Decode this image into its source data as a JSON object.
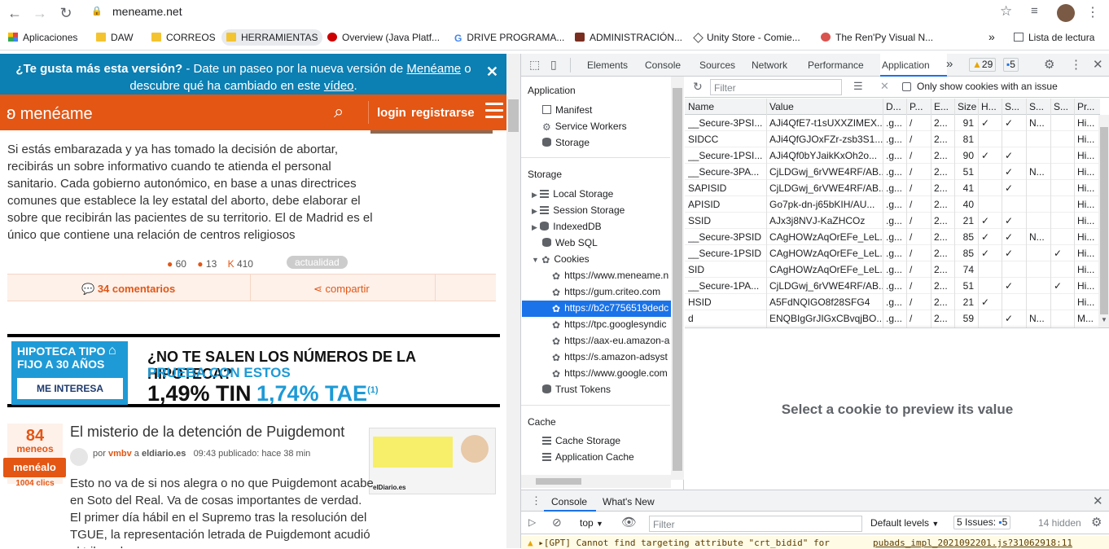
{
  "browser": {
    "url": "meneame.net",
    "bookmarks": [
      "Aplicaciones",
      "DAW",
      "CORREOS",
      "HERRAMIENTAS",
      "Overview (Java Platf...",
      "DRIVE PROGRAMA...",
      "ADMINISTRACIÓN...",
      "Unity Store - Comie...",
      "The Ren'Py Visual N...",
      "Lista de lectura"
    ]
  },
  "site": {
    "banner_q": "¿Te gusta más esta versión?",
    "banner_rest": " - Date un paseo por la nueva versión de ",
    "banner_link": "Menéame",
    "banner_rest2": " o descubre qué ha cambiado en este ",
    "banner_video": "vídeo",
    "banner_end": ".",
    "logo": "menéame",
    "login": "login",
    "register": "registrarse",
    "p1": "Si estás embarazada y ya has tomado la decisión de abortar, recibirás un sobre informativo cuando te atienda el personal sanitario. Cada gobierno autonómico, en base a unas directrices comunes que establece la ley estatal del aborto, debe elaborar el sobre que recibirán las pacientes de su territorio. El de Madrid es el único que contiene una relación de centros religiosos",
    "stat1": "60",
    "stat2": "13",
    "stat3": "410",
    "stat3_prefix": "K",
    "tag": "actualidad",
    "comments": "34 comentarios",
    "share": "compartir",
    "ad_left_title": "HIPOTECA TIPO FIJO A 30 AÑOS",
    "ad_button": "ME INTERESA",
    "ad_headline": "¿NO TE SALEN LOS NÚMEROS DE LA HIPOTECA?",
    "ad_sub": "PRUEBA CON ESTOS",
    "ad_tin": "1,49% TIN",
    "ad_tae": "1,74% TAE",
    "ad_tae_note": "(1)",
    "votes": "84",
    "votes_label": "meneos",
    "menealo": "menéalo",
    "clicks": "1004 clics",
    "title2": "El misterio de la detención de Puigdemont",
    "meta_por": "por",
    "meta_user": "vmbv",
    "meta_a": "a",
    "meta_site": "eldiario.es",
    "meta_time": "09:43 publicado: hace 38 min",
    "thumb_source": "elDiario.es",
    "p2": "Esto no va de si nos alegra o no que Puigdemont acabe en Soto del Real. Va de cosas importantes de verdad. El primer día hábil en el Supremo tras la resolución del TGUE, la representación letrada de Puigdemont acudió al tribunal para"
  },
  "devtools": {
    "tabs": [
      "Elements",
      "Console",
      "Sources",
      "Network",
      "Performance",
      "Application"
    ],
    "more": "»",
    "warnings": "29",
    "messages": "5",
    "sidebar": {
      "app_header": "Application",
      "app_items": [
        "Manifest",
        "Service Workers",
        "Storage"
      ],
      "storage_header": "Storage",
      "storage_items": [
        "Local Storage",
        "Session Storage",
        "IndexedDB",
        "Web SQL",
        "Cookies"
      ],
      "cookie_sites": [
        "https://www.meneame.n",
        "https://gum.criteo.com",
        "https://b2c7756519dedc",
        "https://tpc.googlesyndic",
        "https://aax-eu.amazon-a",
        "https://s.amazon-adsyst",
        "https://www.google.com"
      ],
      "trust": "Trust Tokens",
      "cache_header": "Cache",
      "cache_items": [
        "Cache Storage",
        "Application Cache"
      ]
    },
    "filter_placeholder": "Filter",
    "only_issue": "Only show cookies with an issue",
    "columns": [
      "Name",
      "Value",
      "D...",
      "P...",
      "E...",
      "Size",
      "H...",
      "S...",
      "S...",
      "S...",
      "Pr..."
    ],
    "rows": [
      [
        "__Secure-3PSI...",
        "AJi4QfE7-t1sUXXZIMEX...",
        ".g...",
        "/",
        "2...",
        "91",
        "✓",
        "✓",
        "N...",
        "",
        "Hi..."
      ],
      [
        "SIDCC",
        "AJi4QfGJOxFZr-zsb3S1...",
        ".g...",
        "/",
        "2...",
        "81",
        "",
        "",
        "",
        "",
        "Hi..."
      ],
      [
        "__Secure-1PSI...",
        "AJi4Qf0bYJaikKxOh2o...",
        ".g...",
        "/",
        "2...",
        "90",
        "✓",
        "✓",
        "",
        "",
        "Hi..."
      ],
      [
        "__Secure-3PA...",
        "CjLDGwj_6rVWE4RF/AB...",
        ".g...",
        "/",
        "2...",
        "51",
        "",
        "✓",
        "N...",
        "",
        "Hi..."
      ],
      [
        "SAPISID",
        "CjLDGwj_6rVWE4RF/AB...",
        ".g...",
        "/",
        "2...",
        "41",
        "",
        "✓",
        "",
        "",
        "Hi..."
      ],
      [
        "APISID",
        "Go7pk-dn-j65bKIH/AU...",
        ".g...",
        "/",
        "2...",
        "40",
        "",
        "",
        "",
        "",
        "Hi..."
      ],
      [
        "SSID",
        "AJx3j8NVJ-KaZHCOz",
        ".g...",
        "/",
        "2...",
        "21",
        "✓",
        "✓",
        "",
        "",
        "Hi..."
      ],
      [
        "__Secure-3PSID",
        "CAgHOWzAqOrEFe_LeL...",
        ".g...",
        "/",
        "2...",
        "85",
        "✓",
        "✓",
        "N...",
        "",
        "Hi..."
      ],
      [
        "__Secure-1PSID",
        "CAgHOWzAqOrEFe_LeL...",
        ".g...",
        "/",
        "2...",
        "85",
        "✓",
        "✓",
        "",
        "✓",
        "Hi..."
      ],
      [
        "SID",
        "CAgHOWzAqOrEFe_LeL...",
        ".g...",
        "/",
        "2...",
        "74",
        "",
        "",
        "",
        "",
        "Hi..."
      ],
      [
        "__Secure-1PA...",
        "CjLDGwj_6rVWE4RF/AB...",
        ".g...",
        "/",
        "2...",
        "51",
        "",
        "✓",
        "",
        "✓",
        "Hi..."
      ],
      [
        "HSID",
        "A5FdNQIGO8f28SFG4",
        ".g...",
        "/",
        "2...",
        "21",
        "✓",
        "",
        "",
        "",
        "Hi..."
      ],
      [
        "d",
        "ENQBIgGrJIGxCBvqjBO...",
        ".g...",
        "/",
        "2...",
        "59",
        "",
        "✓",
        "N...",
        "",
        "M..."
      ]
    ],
    "preview": "Select a cookie to preview its value",
    "drawer_tabs": [
      "Console",
      "What's New"
    ],
    "context": "top",
    "console_filter": "Filter",
    "levels": "Default levels",
    "issues": "5 Issues:",
    "issues_count": "5",
    "hidden": "14 hidden",
    "warn_text": "▸[GPT] Cannot find targeting attribute \"crt_bidid\" for",
    "warn_src": "pubads_impl_2021092201.js?31062918:11"
  }
}
